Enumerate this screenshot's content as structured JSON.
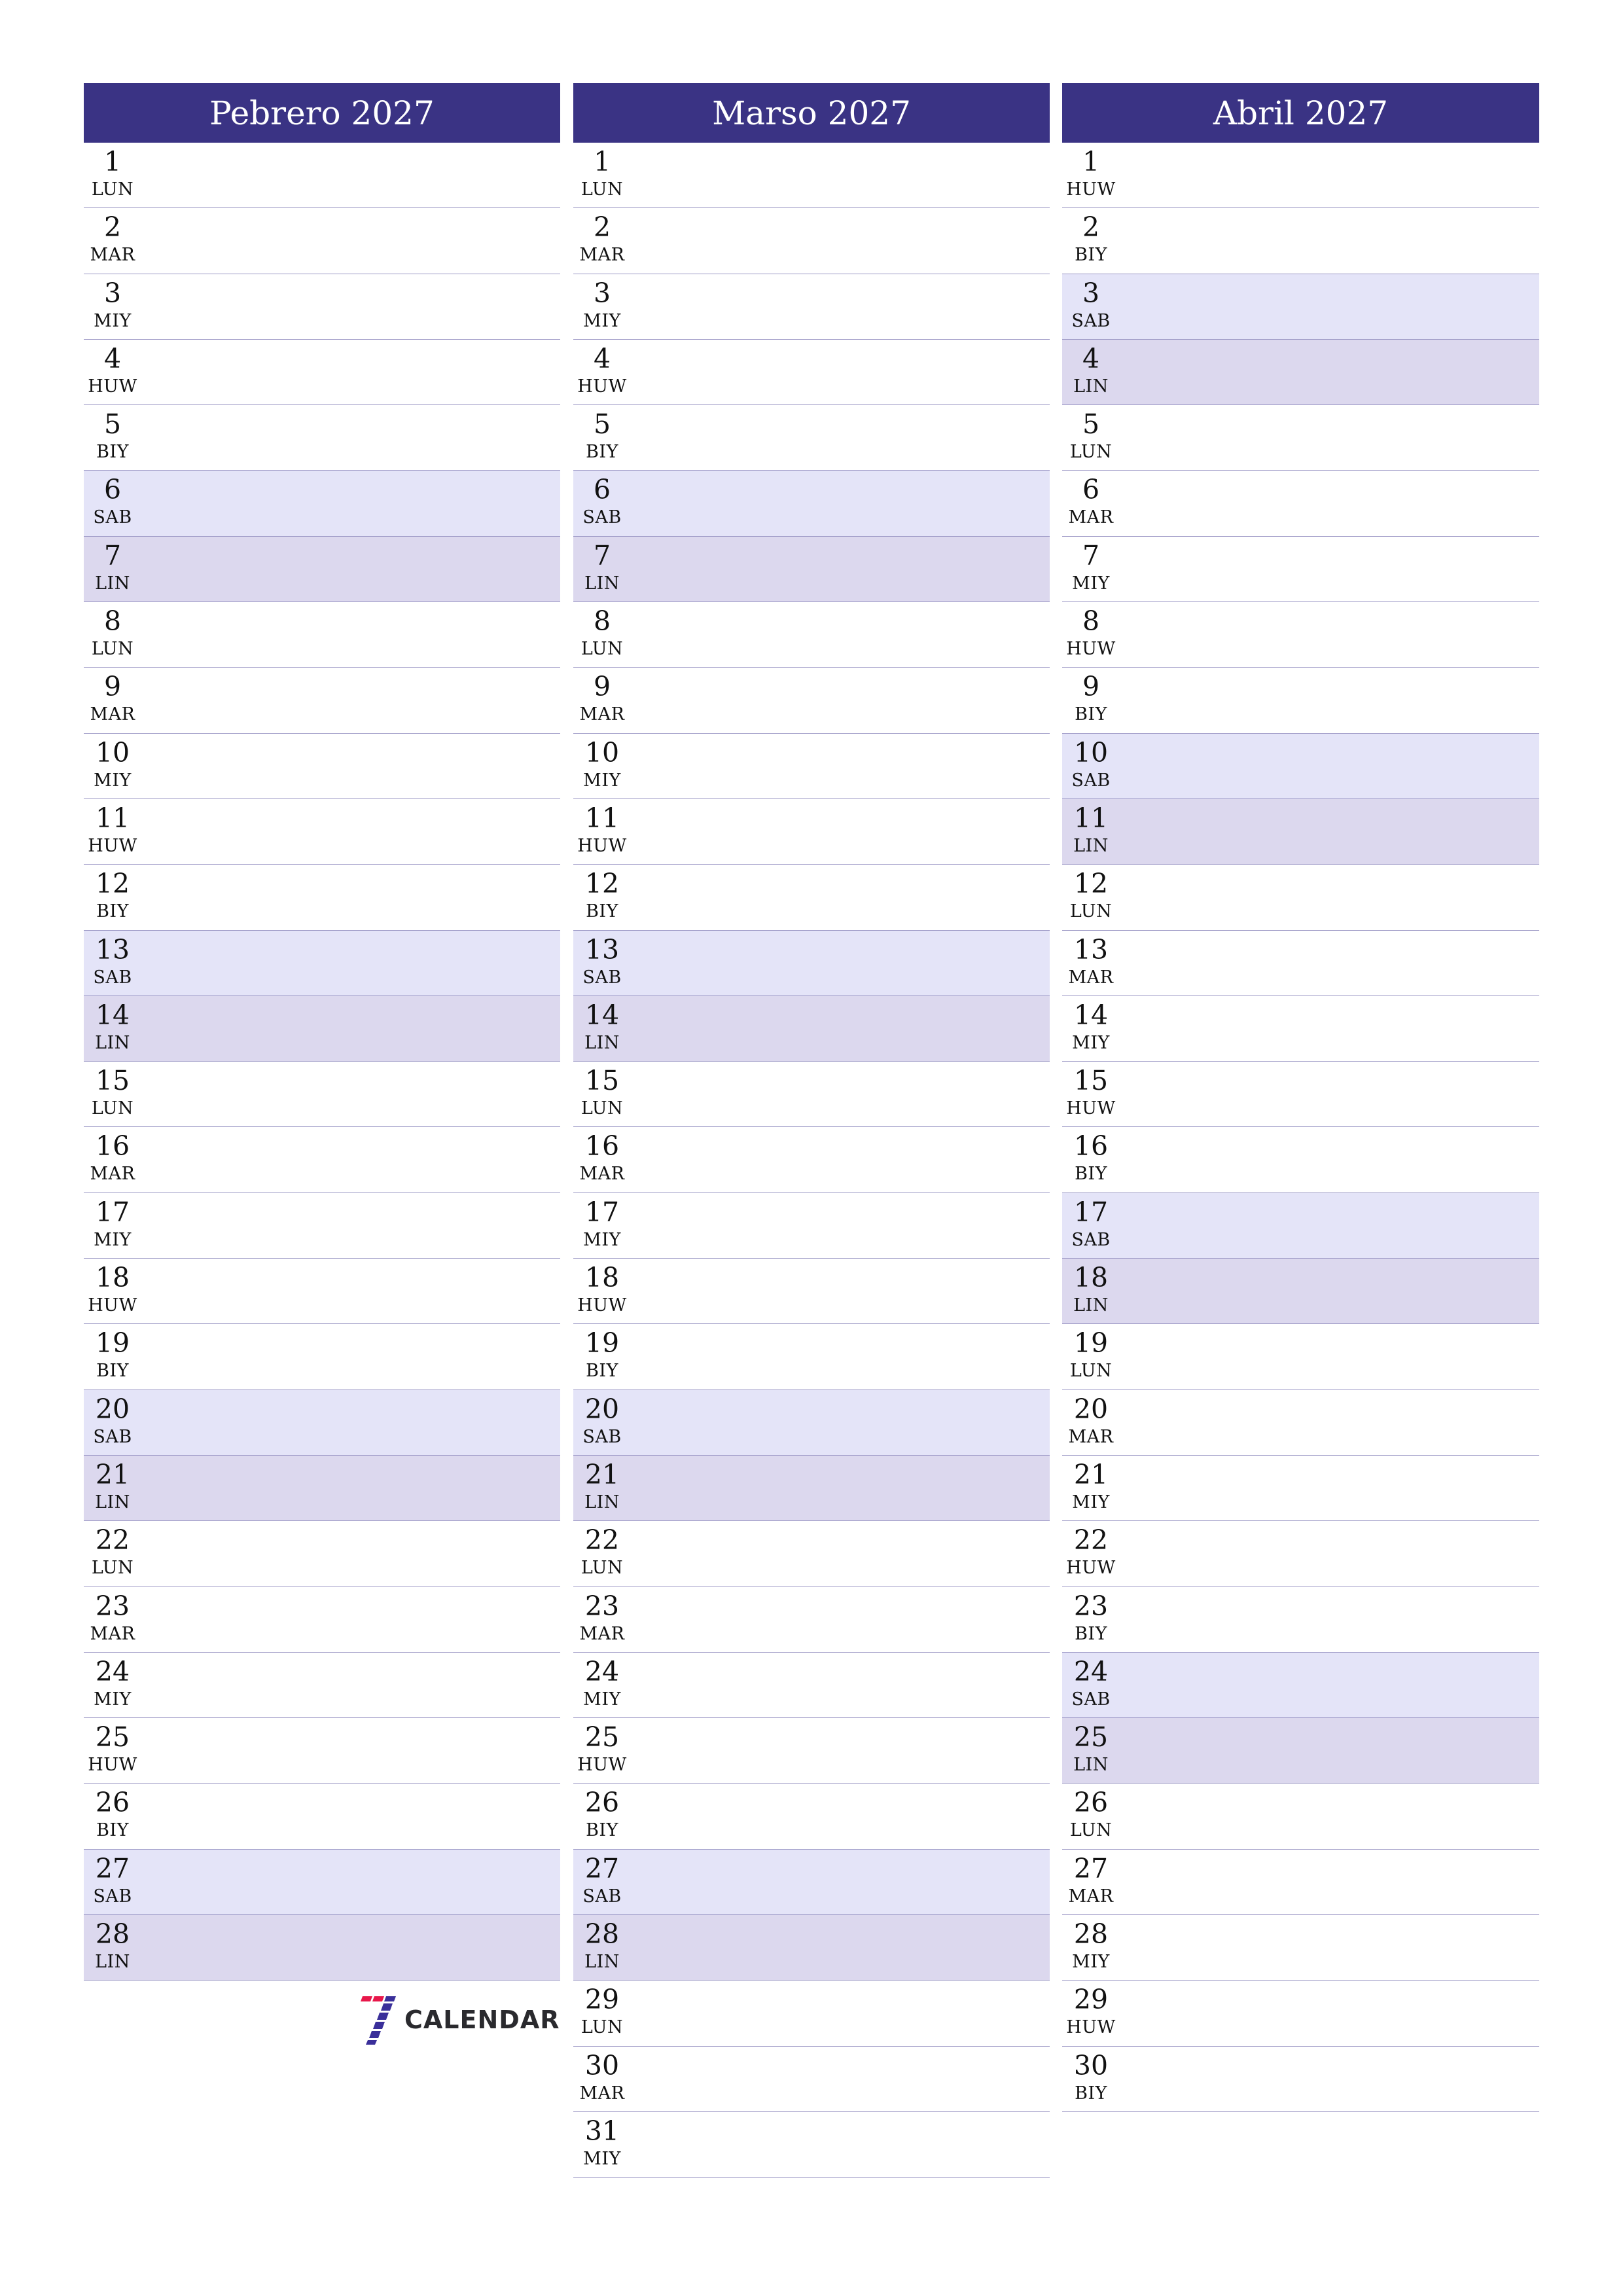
{
  "colors": {
    "header_bg": "#3A3384",
    "saturday_bg": "#E4E4F8",
    "sunday_bg": "#DCD8EE",
    "row_divider": "#9A96C4",
    "logo_red": "#E8174A",
    "logo_blue": "#3A2F9A"
  },
  "months": [
    {
      "title": "Pebrero 2027",
      "days": [
        {
          "num": "1",
          "abbr": "LUN",
          "type": "weekday"
        },
        {
          "num": "2",
          "abbr": "MAR",
          "type": "weekday"
        },
        {
          "num": "3",
          "abbr": "MIY",
          "type": "weekday"
        },
        {
          "num": "4",
          "abbr": "HUW",
          "type": "weekday"
        },
        {
          "num": "5",
          "abbr": "BIY",
          "type": "weekday"
        },
        {
          "num": "6",
          "abbr": "SAB",
          "type": "sat"
        },
        {
          "num": "7",
          "abbr": "LIN",
          "type": "sun"
        },
        {
          "num": "8",
          "abbr": "LUN",
          "type": "weekday"
        },
        {
          "num": "9",
          "abbr": "MAR",
          "type": "weekday"
        },
        {
          "num": "10",
          "abbr": "MIY",
          "type": "weekday"
        },
        {
          "num": "11",
          "abbr": "HUW",
          "type": "weekday"
        },
        {
          "num": "12",
          "abbr": "BIY",
          "type": "weekday"
        },
        {
          "num": "13",
          "abbr": "SAB",
          "type": "sat"
        },
        {
          "num": "14",
          "abbr": "LIN",
          "type": "sun"
        },
        {
          "num": "15",
          "abbr": "LUN",
          "type": "weekday"
        },
        {
          "num": "16",
          "abbr": "MAR",
          "type": "weekday"
        },
        {
          "num": "17",
          "abbr": "MIY",
          "type": "weekday"
        },
        {
          "num": "18",
          "abbr": "HUW",
          "type": "weekday"
        },
        {
          "num": "19",
          "abbr": "BIY",
          "type": "weekday"
        },
        {
          "num": "20",
          "abbr": "SAB",
          "type": "sat"
        },
        {
          "num": "21",
          "abbr": "LIN",
          "type": "sun"
        },
        {
          "num": "22",
          "abbr": "LUN",
          "type": "weekday"
        },
        {
          "num": "23",
          "abbr": "MAR",
          "type": "weekday"
        },
        {
          "num": "24",
          "abbr": "MIY",
          "type": "weekday"
        },
        {
          "num": "25",
          "abbr": "HUW",
          "type": "weekday"
        },
        {
          "num": "26",
          "abbr": "BIY",
          "type": "weekday"
        },
        {
          "num": "27",
          "abbr": "SAB",
          "type": "sat"
        },
        {
          "num": "28",
          "abbr": "LIN",
          "type": "sun"
        }
      ]
    },
    {
      "title": "Marso 2027",
      "days": [
        {
          "num": "1",
          "abbr": "LUN",
          "type": "weekday"
        },
        {
          "num": "2",
          "abbr": "MAR",
          "type": "weekday"
        },
        {
          "num": "3",
          "abbr": "MIY",
          "type": "weekday"
        },
        {
          "num": "4",
          "abbr": "HUW",
          "type": "weekday"
        },
        {
          "num": "5",
          "abbr": "BIY",
          "type": "weekday"
        },
        {
          "num": "6",
          "abbr": "SAB",
          "type": "sat"
        },
        {
          "num": "7",
          "abbr": "LIN",
          "type": "sun"
        },
        {
          "num": "8",
          "abbr": "LUN",
          "type": "weekday"
        },
        {
          "num": "9",
          "abbr": "MAR",
          "type": "weekday"
        },
        {
          "num": "10",
          "abbr": "MIY",
          "type": "weekday"
        },
        {
          "num": "11",
          "abbr": "HUW",
          "type": "weekday"
        },
        {
          "num": "12",
          "abbr": "BIY",
          "type": "weekday"
        },
        {
          "num": "13",
          "abbr": "SAB",
          "type": "sat"
        },
        {
          "num": "14",
          "abbr": "LIN",
          "type": "sun"
        },
        {
          "num": "15",
          "abbr": "LUN",
          "type": "weekday"
        },
        {
          "num": "16",
          "abbr": "MAR",
          "type": "weekday"
        },
        {
          "num": "17",
          "abbr": "MIY",
          "type": "weekday"
        },
        {
          "num": "18",
          "abbr": "HUW",
          "type": "weekday"
        },
        {
          "num": "19",
          "abbr": "BIY",
          "type": "weekday"
        },
        {
          "num": "20",
          "abbr": "SAB",
          "type": "sat"
        },
        {
          "num": "21",
          "abbr": "LIN",
          "type": "sun"
        },
        {
          "num": "22",
          "abbr": "LUN",
          "type": "weekday"
        },
        {
          "num": "23",
          "abbr": "MAR",
          "type": "weekday"
        },
        {
          "num": "24",
          "abbr": "MIY",
          "type": "weekday"
        },
        {
          "num": "25",
          "abbr": "HUW",
          "type": "weekday"
        },
        {
          "num": "26",
          "abbr": "BIY",
          "type": "weekday"
        },
        {
          "num": "27",
          "abbr": "SAB",
          "type": "sat"
        },
        {
          "num": "28",
          "abbr": "LIN",
          "type": "sun"
        },
        {
          "num": "29",
          "abbr": "LUN",
          "type": "weekday"
        },
        {
          "num": "30",
          "abbr": "MAR",
          "type": "weekday"
        },
        {
          "num": "31",
          "abbr": "MIY",
          "type": "weekday"
        }
      ]
    },
    {
      "title": "Abril 2027",
      "days": [
        {
          "num": "1",
          "abbr": "HUW",
          "type": "weekday"
        },
        {
          "num": "2",
          "abbr": "BIY",
          "type": "weekday"
        },
        {
          "num": "3",
          "abbr": "SAB",
          "type": "sat"
        },
        {
          "num": "4",
          "abbr": "LIN",
          "type": "sun"
        },
        {
          "num": "5",
          "abbr": "LUN",
          "type": "weekday"
        },
        {
          "num": "6",
          "abbr": "MAR",
          "type": "weekday"
        },
        {
          "num": "7",
          "abbr": "MIY",
          "type": "weekday"
        },
        {
          "num": "8",
          "abbr": "HUW",
          "type": "weekday"
        },
        {
          "num": "9",
          "abbr": "BIY",
          "type": "weekday"
        },
        {
          "num": "10",
          "abbr": "SAB",
          "type": "sat"
        },
        {
          "num": "11",
          "abbr": "LIN",
          "type": "sun"
        },
        {
          "num": "12",
          "abbr": "LUN",
          "type": "weekday"
        },
        {
          "num": "13",
          "abbr": "MAR",
          "type": "weekday"
        },
        {
          "num": "14",
          "abbr": "MIY",
          "type": "weekday"
        },
        {
          "num": "15",
          "abbr": "HUW",
          "type": "weekday"
        },
        {
          "num": "16",
          "abbr": "BIY",
          "type": "weekday"
        },
        {
          "num": "17",
          "abbr": "SAB",
          "type": "sat"
        },
        {
          "num": "18",
          "abbr": "LIN",
          "type": "sun"
        },
        {
          "num": "19",
          "abbr": "LUN",
          "type": "weekday"
        },
        {
          "num": "20",
          "abbr": "MAR",
          "type": "weekday"
        },
        {
          "num": "21",
          "abbr": "MIY",
          "type": "weekday"
        },
        {
          "num": "22",
          "abbr": "HUW",
          "type": "weekday"
        },
        {
          "num": "23",
          "abbr": "BIY",
          "type": "weekday"
        },
        {
          "num": "24",
          "abbr": "SAB",
          "type": "sat"
        },
        {
          "num": "25",
          "abbr": "LIN",
          "type": "sun"
        },
        {
          "num": "26",
          "abbr": "LUN",
          "type": "weekday"
        },
        {
          "num": "27",
          "abbr": "MAR",
          "type": "weekday"
        },
        {
          "num": "28",
          "abbr": "MIY",
          "type": "weekday"
        },
        {
          "num": "29",
          "abbr": "HUW",
          "type": "weekday"
        },
        {
          "num": "30",
          "abbr": "BIY",
          "type": "weekday"
        }
      ]
    }
  ],
  "logo": {
    "text": "CALENDAR",
    "icon": "seven-stripes-logo-icon"
  }
}
